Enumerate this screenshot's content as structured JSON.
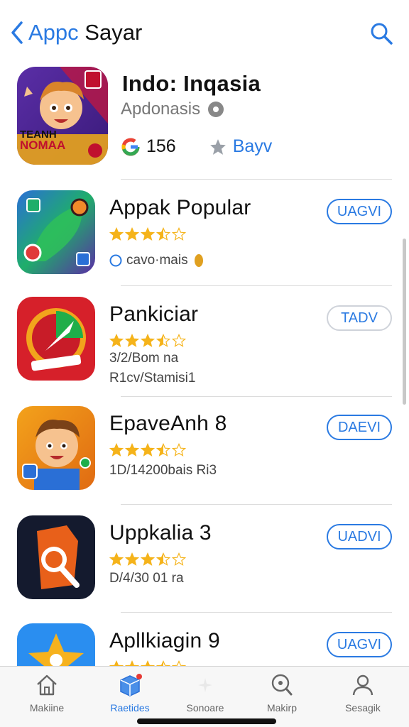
{
  "nav": {
    "title_part1": "Appc",
    "title_part2": "Sayar",
    "accent": "#2a7ae2"
  },
  "featured": {
    "name": "Indo: Inqasia",
    "developer": "Apdonasis",
    "icon_text_top": "TEANH",
    "icon_text_bottom": "NOMAA",
    "rating_count": "156",
    "get_label": "Bayv"
  },
  "apps": [
    {
      "name": "Appak Popular",
      "rating": 3.5,
      "meta": "cavo·mais",
      "button": "UAGVI",
      "button_style": "blue"
    },
    {
      "name": "Pankiciar",
      "rating": 3.5,
      "meta": "3/2/Bom na",
      "meta2": "R1cv/Stamisi1",
      "button": "TADV",
      "button_style": "gray"
    },
    {
      "name": "EpaveAnh 8",
      "rating": 3.5,
      "meta": "1D/14200bais Ri3",
      "button": "DAEVI",
      "button_style": "blue"
    },
    {
      "name": "Uppkalia 3",
      "rating": 3.5,
      "meta": "D/4/30 01 ra",
      "button": "UADVI",
      "button_style": "blue"
    },
    {
      "name": "Apllkiagin 9",
      "rating": 3.5,
      "meta": "",
      "button": "UAGVI",
      "button_style": "blue"
    }
  ],
  "tabs": [
    {
      "label": "Makiine",
      "icon": "home-icon",
      "active": false
    },
    {
      "label": "Raetides",
      "icon": "box-icon",
      "active": true
    },
    {
      "label": "Sonoare",
      "icon": "sparkle-icon",
      "active": false
    },
    {
      "label": "Makirp",
      "icon": "search-icon",
      "active": false
    },
    {
      "label": "Sesagik",
      "icon": "person-icon",
      "active": false
    }
  ]
}
